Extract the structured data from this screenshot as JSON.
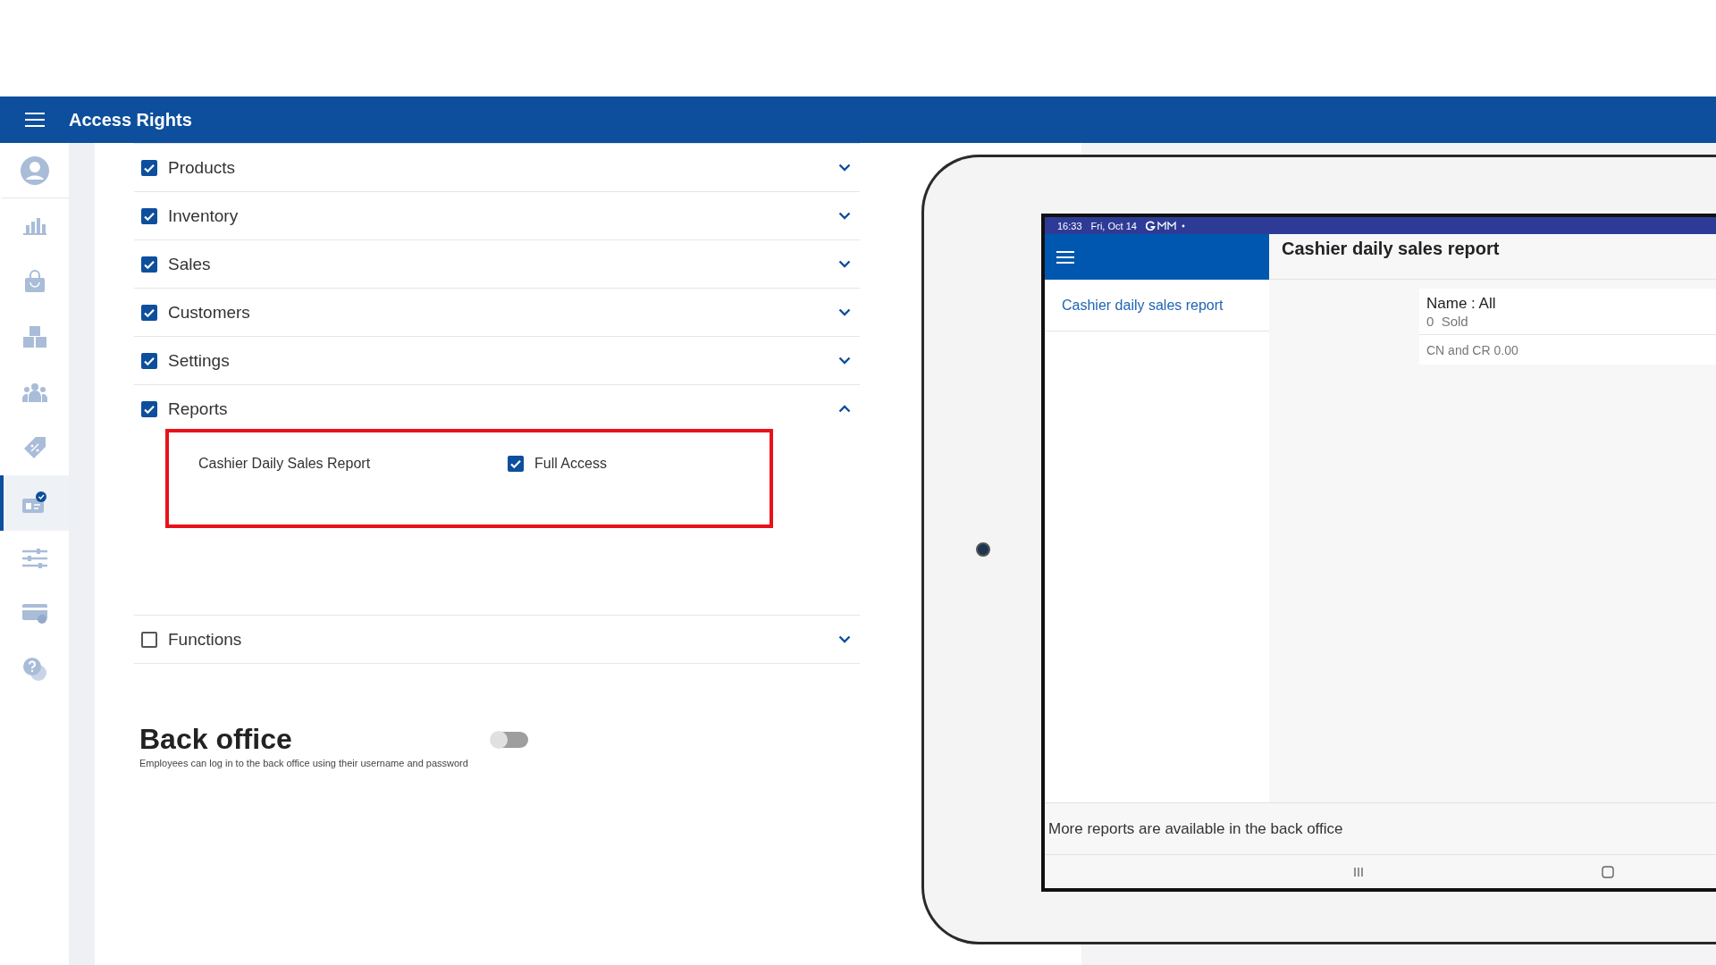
{
  "header": {
    "title": "Access Rights"
  },
  "sidebar": {
    "items": [
      {
        "kind": "profile",
        "selected": false
      },
      {
        "kind": "chart",
        "selected": false
      },
      {
        "kind": "bag",
        "selected": false
      },
      {
        "kind": "boxes",
        "selected": false
      },
      {
        "kind": "people",
        "selected": false
      },
      {
        "kind": "tag",
        "selected": false
      },
      {
        "kind": "badge",
        "selected": true
      },
      {
        "kind": "sliders",
        "selected": false
      },
      {
        "kind": "card",
        "selected": false
      },
      {
        "kind": "help",
        "selected": false
      }
    ]
  },
  "permissions": [
    {
      "label": "Products",
      "checked": true,
      "expanded": false
    },
    {
      "label": "Inventory",
      "checked": true,
      "expanded": false
    },
    {
      "label": "Sales",
      "checked": true,
      "expanded": false
    },
    {
      "label": "Customers",
      "checked": true,
      "expanded": false
    },
    {
      "label": "Settings",
      "checked": true,
      "expanded": false
    },
    {
      "label": "Reports",
      "checked": true,
      "expanded": true,
      "highlighted": true,
      "children": [
        {
          "label": "Cashier Daily Sales Report",
          "access_label": "Full Access",
          "checked": true
        }
      ]
    },
    {
      "label": "Functions",
      "checked": false,
      "expanded": false
    }
  ],
  "back_office": {
    "title": "Back office",
    "description": "Employees can log in to the back office using their username and password",
    "on": false
  },
  "tablet": {
    "status_bar": {
      "time": "16:33",
      "date": "Fri, Oct 14"
    },
    "menu": [
      {
        "label": "Cashier daily sales report"
      }
    ],
    "title": "Cashier daily sales report",
    "card": {
      "name": "Name : All",
      "sold": "0  Sold",
      "total": "CN and CR 0.00"
    },
    "footer": "More reports are available in the back office"
  }
}
